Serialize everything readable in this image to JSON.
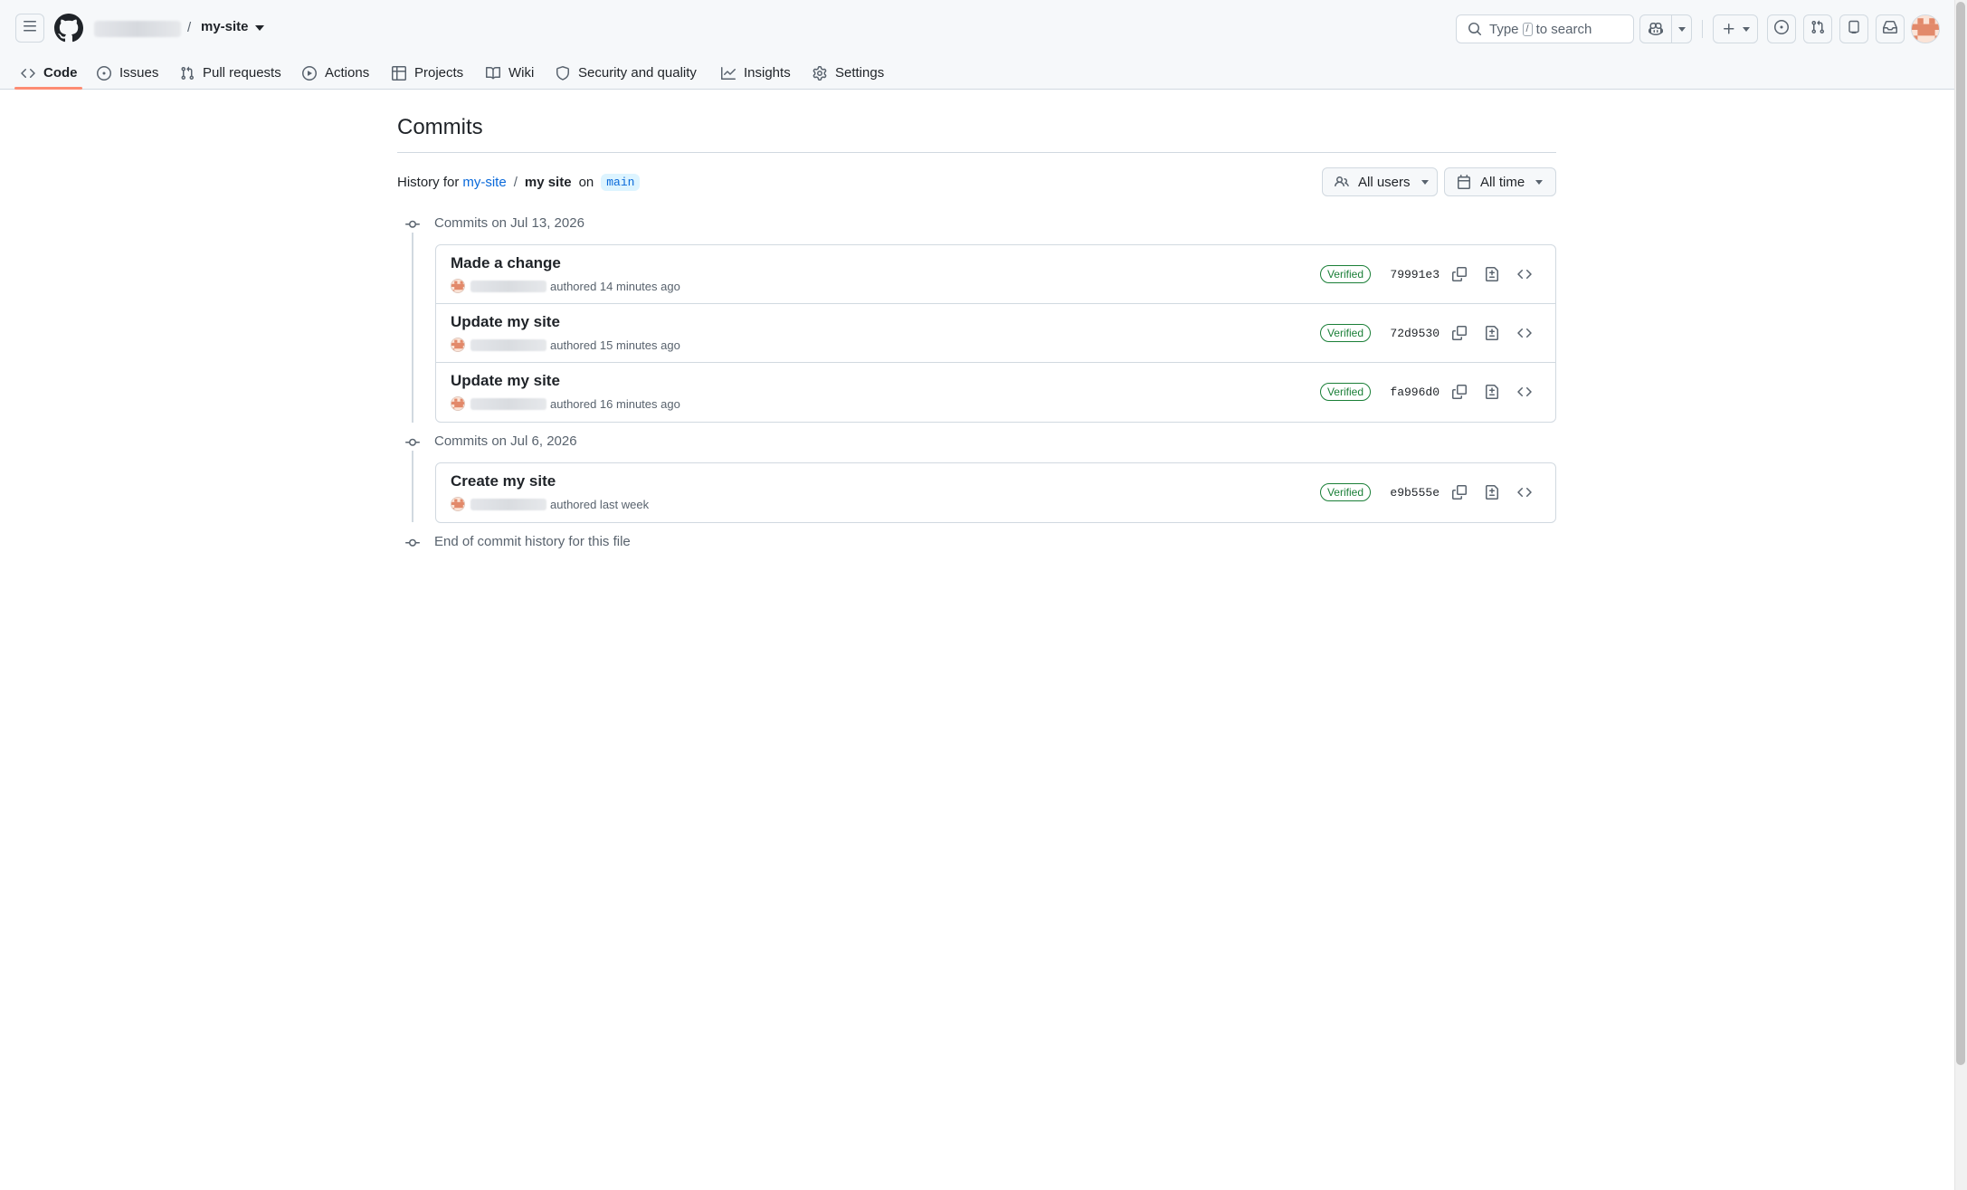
{
  "header": {
    "repo_name": "my-site",
    "search_prefix": "Type",
    "search_key": "/",
    "search_suffix": "to search",
    "icons": [
      "menu-icon",
      "github-logo-icon",
      "search-icon",
      "copilot-icon",
      "plus-icon",
      "issue-icon",
      "pull-request-icon",
      "copilot-icon",
      "inbox-icon"
    ]
  },
  "nav": {
    "items": [
      {
        "label": "Code",
        "icon": "code-icon"
      },
      {
        "label": "Issues",
        "icon": "issue-icon"
      },
      {
        "label": "Pull requests",
        "icon": "pull-request-icon"
      },
      {
        "label": "Actions",
        "icon": "play-icon"
      },
      {
        "label": "Projects",
        "icon": "table-icon"
      },
      {
        "label": "Wiki",
        "icon": "book-icon"
      },
      {
        "label": "Security and quality",
        "icon": "shield-icon"
      },
      {
        "label": "Insights",
        "icon": "graph-icon"
      },
      {
        "label": "Settings",
        "icon": "gear-icon"
      }
    ],
    "active": "Code"
  },
  "page": {
    "title": "Commits",
    "history_prefix": "History for",
    "history_repo": "my-site",
    "history_sep": "/",
    "history_file": "my site",
    "history_on": "on",
    "branch": "main",
    "filters": {
      "users": "All users",
      "time": "All time"
    }
  },
  "groups": [
    {
      "date_label": "Commits on Jul 13, 2026",
      "commits": [
        {
          "message": "Made a change",
          "authored": "authored 14 minutes ago",
          "verified": "Verified",
          "sha": "79991e3"
        },
        {
          "message": "Update my site",
          "authored": "authored 15 minutes ago",
          "verified": "Verified",
          "sha": "72d9530"
        },
        {
          "message": "Update my site",
          "authored": "authored 16 minutes ago",
          "verified": "Verified",
          "sha": "fa996d0"
        }
      ]
    },
    {
      "date_label": "Commits on Jul 6, 2026",
      "commits": [
        {
          "message": "Create my site",
          "authored": "authored last week",
          "verified": "Verified",
          "sha": "e9b555e"
        }
      ]
    }
  ],
  "end_text": "End of commit history for this file",
  "colors": {
    "accent_link": "#0969da",
    "verified_green": "#1a7f37",
    "nav_underline": "#fd8c73"
  }
}
